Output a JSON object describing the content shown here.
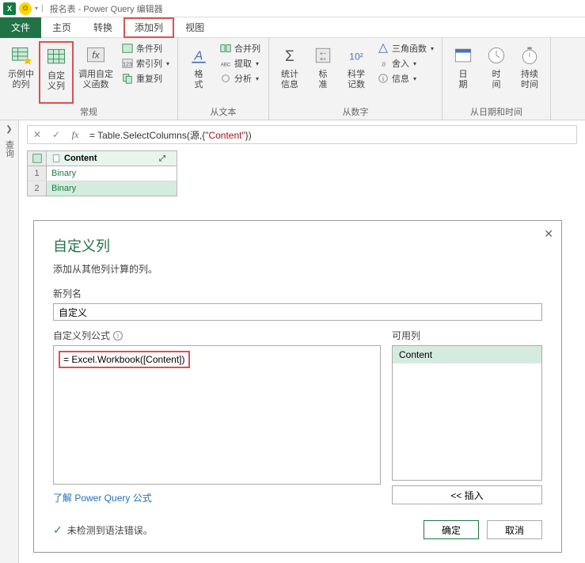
{
  "titlebar": {
    "title": "报名表 - Power Query 编辑器"
  },
  "tabs": {
    "file": "文件",
    "home": "主页",
    "transform": "转换",
    "addcol": "添加列",
    "view": "视图"
  },
  "ribbon": {
    "general": {
      "label": "常规",
      "example_col": "示例中\n的列",
      "custom_col": "自定\n义列",
      "invoke_fn": "调用自定\n义函数",
      "cond_col": "条件列",
      "index_col": "索引列",
      "dup_col": "重复列"
    },
    "from_text": {
      "label": "从文本",
      "format": "格\n式",
      "merge": "合并列",
      "extract": "提取",
      "parse": "分析"
    },
    "from_number": {
      "label": "从数字",
      "stats": "统计\n信息",
      "standard": "标\n准",
      "scientific": "科学\n记数",
      "trig": "三角函数",
      "round": "舍入",
      "info": "信息"
    },
    "from_datetime": {
      "label": "从日期和时间",
      "date": "日\n期",
      "time": "时\n间",
      "duration": "持续\n时间"
    }
  },
  "formula_bar": {
    "prefix": "= Table.SelectColumns(源,{",
    "string": "\"Content\"",
    "suffix": "})"
  },
  "table": {
    "header": "Content",
    "rows": [
      {
        "n": "1",
        "v": "Binary"
      },
      {
        "n": "2",
        "v": "Binary"
      }
    ]
  },
  "dialog": {
    "title": "自定义列",
    "desc": "添加从其他列计算的列。",
    "newcol_label": "新列名",
    "newcol_value": "自定义",
    "formula_label": "自定义列公式",
    "formula_text": "= Excel.Workbook([Content])",
    "available_label": "可用列",
    "available_item": "Content",
    "insert_btn": "<< 插入",
    "learn_link": "了解 Power Query 公式",
    "status_text": "未检测到语法错误。",
    "ok": "确定",
    "cancel": "取消"
  }
}
